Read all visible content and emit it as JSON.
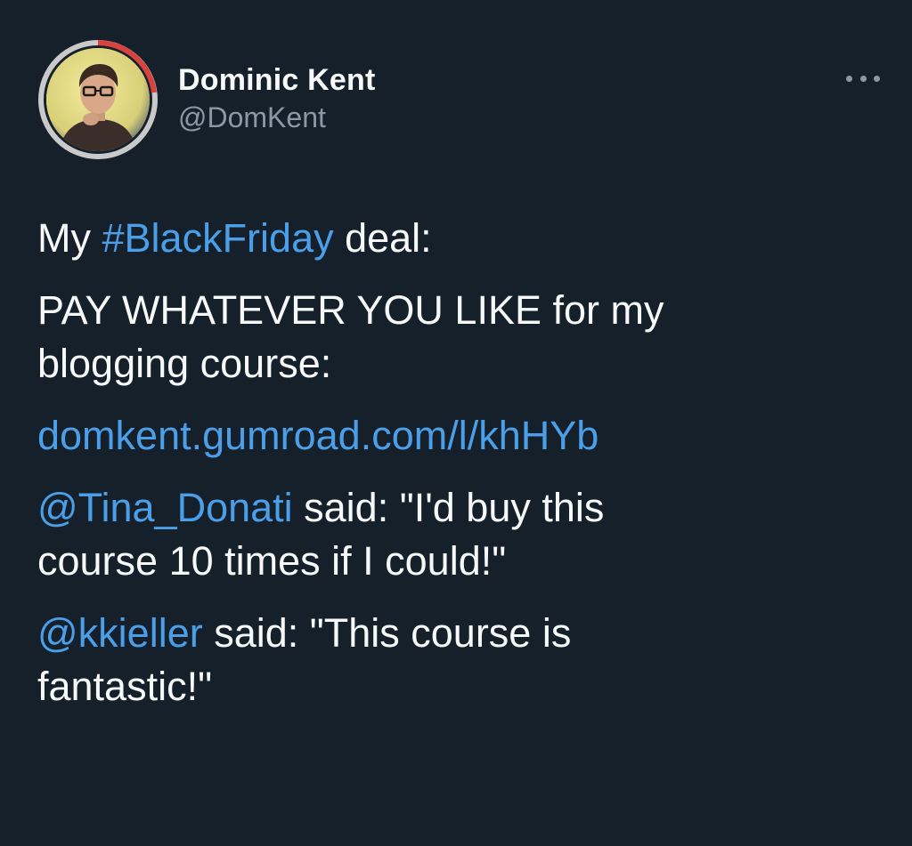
{
  "tweet": {
    "author": {
      "display_name": "Dominic Kent",
      "handle": "@DomKent"
    },
    "more_icon": "more-horizontal-icon",
    "body": {
      "line1_before": "My ",
      "line1_hashtag": "#BlackFriday",
      "line1_after": " deal:",
      "line2a": "PAY WHATEVER YOU LIKE for my",
      "line2b": "blogging course:",
      "link": "domkent.gumroad.com/l/khHYb",
      "quote1_mention": "@Tina_Donati",
      "quote1_after": " said: \"I'd buy this",
      "quote1_line2": "course 10 times if I could!\"",
      "quote2_mention": "@kkieller",
      "quote2_after": " said: \"This course is",
      "quote2_line2": "fantastic!\""
    }
  },
  "colors": {
    "background": "#15202b",
    "text": "#f7f9f9",
    "secondary_text": "#8b98a5",
    "link": "#4a9fe8"
  }
}
